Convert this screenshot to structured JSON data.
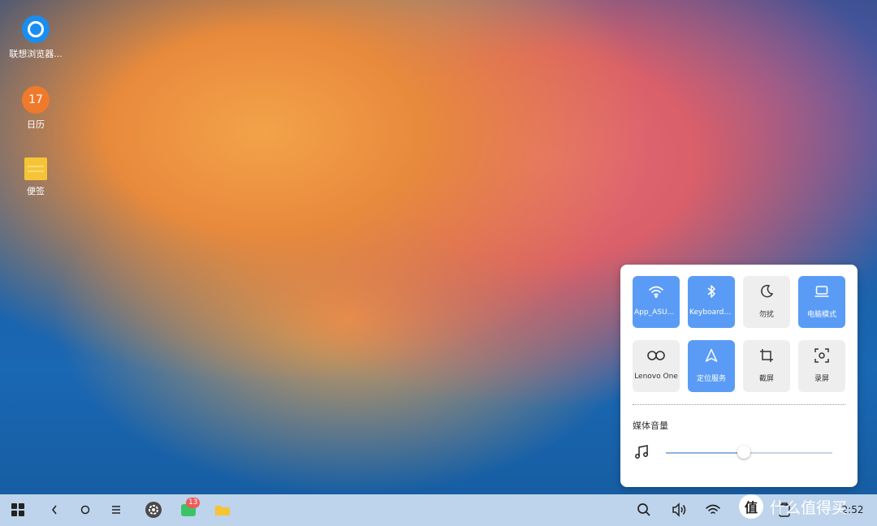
{
  "desktop": {
    "icons": [
      {
        "label": "联想浏览器..."
      },
      {
        "label": "日历",
        "day": "17"
      },
      {
        "label": "便签"
      }
    ]
  },
  "quick_panel": {
    "tiles": [
      {
        "label": "App_ASUS_...",
        "icon": "wifi-icon",
        "active": true
      },
      {
        "label": "Keyboard K...",
        "icon": "bluetooth-icon",
        "active": true
      },
      {
        "label": "勿扰",
        "icon": "moon-icon",
        "active": false
      },
      {
        "label": "电脑模式",
        "icon": "laptop-icon",
        "active": true
      },
      {
        "label": "Lenovo One",
        "icon": "infinity-icon",
        "active": false
      },
      {
        "label": "定位服务",
        "icon": "location-icon",
        "active": true
      },
      {
        "label": "截屏",
        "icon": "crop-icon",
        "active": false
      },
      {
        "label": "录屏",
        "icon": "screen-record-icon",
        "active": false
      }
    ],
    "volume_label": "媒体音量",
    "volume_level": 0.47
  },
  "taskbar": {
    "messages_badge": "13",
    "clock": "2:52"
  },
  "watermark": {
    "badge": "值",
    "text": "什么值得买"
  },
  "colors": {
    "accent": "#5a9cf5",
    "tile_inactive": "#eeeeee",
    "badge": "#ef5a5a"
  }
}
